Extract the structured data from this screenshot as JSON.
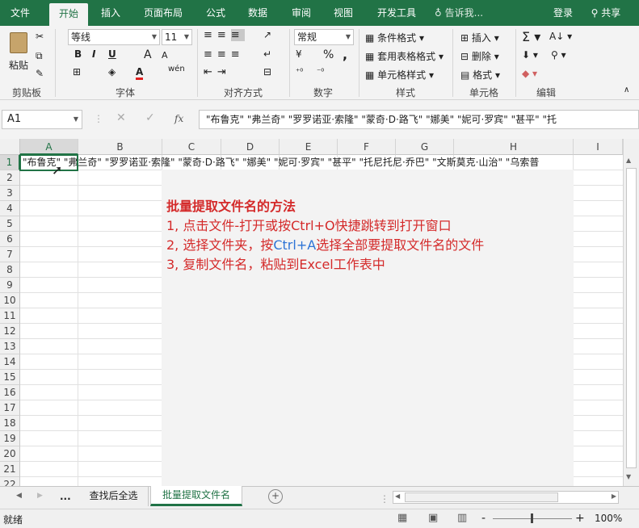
{
  "menu": {
    "items": [
      "文件",
      "开始",
      "插入",
      "页面布局",
      "公式",
      "数据",
      "审阅",
      "视图",
      "开发工具"
    ],
    "tell_me": "告诉我...",
    "login": "登录",
    "share": "共享"
  },
  "ribbon": {
    "clipboard": {
      "paste": "粘贴",
      "group": "剪贴板"
    },
    "font": {
      "name": "等线",
      "size": "11",
      "group": "字体",
      "bold": "B",
      "italic": "I",
      "underline": "U",
      "grow": "A",
      "shrink": "A",
      "color_a": "A",
      "wen": "wén"
    },
    "align": {
      "group": "对齐方式"
    },
    "number": {
      "format": "常规",
      "group": "数字",
      "percent": "%",
      "comma": ","
    },
    "styles": {
      "cond": "条件格式",
      "table": "套用表格格式",
      "cell": "单元格样式",
      "group": "样式"
    },
    "cells": {
      "insert": "插入",
      "delete": "删除",
      "format": "格式",
      "group": "单元格"
    },
    "editing": {
      "group": "编辑"
    }
  },
  "formula_bar": {
    "name_box": "A1",
    "fx": "fx",
    "content": "\"布鲁克\" \"弗兰奇\" \"罗罗诺亚·索隆\" \"蒙奇·D·路飞\" \"娜美\" \"妮可·罗宾\" \"甚平\" \"托"
  },
  "grid": {
    "columns": [
      "A",
      "B",
      "C",
      "D",
      "E",
      "F",
      "G",
      "H",
      "I"
    ],
    "rows": [
      "1",
      "2",
      "3",
      "4",
      "5",
      "6",
      "7",
      "8",
      "9",
      "10",
      "11",
      "12",
      "13",
      "14",
      "15",
      "16",
      "17",
      "18",
      "19",
      "20",
      "21",
      "22"
    ],
    "row1_text": "\"布鲁克\" \"弗兰奇\" \"罗罗诺亚·索隆\" \"蒙奇·D·路飞\" \"娜美\" \"妮可·罗宾\" \"甚平\" \"托尼托尼·乔巴\" \"文斯莫克·山治\" \"乌索普"
  },
  "note": {
    "title": "批量提取文件名的方法",
    "line1": "1, 点击文件-打开或按Ctrl+O快捷跳转到打开窗口",
    "line2_a": "2, 选择文件夹，按",
    "line2_b": "Ctrl+A",
    "line2_c": "选择全部要提取文件名的文件",
    "line3": "3, 复制文件名，粘贴到Excel工作表中"
  },
  "sheets": {
    "ellipsis": "...",
    "tabs": [
      "查找后全选",
      "批量提取文件名"
    ],
    "active": "批量提取文件名",
    "add": "+"
  },
  "status": {
    "ready": "就绪",
    "zoom": "100%",
    "minus": "-",
    "plus": "+"
  },
  "colors": {
    "brand": "#217346",
    "note_red": "#d42a2a",
    "note_blue": "#2e74d6"
  }
}
